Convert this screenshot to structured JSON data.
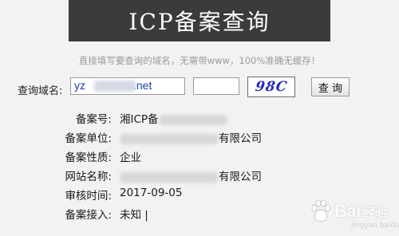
{
  "header": {
    "title": "ICP备案查询"
  },
  "hint": "直接填写要查询的域名，无需带www，100%准确无缓存！",
  "query": {
    "label": "查询域名:",
    "domain_prefix": "yz",
    "domain_suffix": ".net",
    "captcha_input_value": "",
    "captcha_text": "98C",
    "button_label": "查 询"
  },
  "results": [
    {
      "label": "备案号:",
      "value": "湘ICP备",
      "masked": "after"
    },
    {
      "label": "备案单位:",
      "value": "有限公司",
      "masked": "before"
    },
    {
      "label": "备案性质:",
      "value": "企业",
      "masked": "none"
    },
    {
      "label": "网站名称:",
      "value": "有限公司",
      "masked": "before"
    },
    {
      "label": "审核时间:",
      "value": "2017-09-05",
      "masked": "none"
    },
    {
      "label": "备案接入:",
      "value": "未知 |",
      "masked": "none"
    }
  ],
  "watermark": {
    "text": "Bai",
    "text2": "经验",
    "sub": "jingyan.baidu.com"
  }
}
